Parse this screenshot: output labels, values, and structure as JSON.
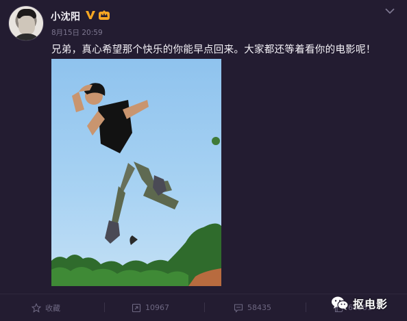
{
  "post": {
    "username": "小沈阳",
    "timestamp": "8月15日 20:59",
    "text": "兄弟，真心希望那个快乐的你能早点回来。大家都还等着看你的电影呢！"
  },
  "actions": {
    "favorite_label": "收藏",
    "repost_count": "10967",
    "comment_count": "58435",
    "like_count": "60551"
  },
  "watermark": {
    "text": "抠电影"
  },
  "icons": {
    "verified": "verified-v-icon",
    "member": "member-crown-icon",
    "more": "chevron-down-icon",
    "favorite": "star-icon",
    "repost": "repost-icon",
    "comment": "comment-icon",
    "like": "thumb-up-icon",
    "watermark_logo": "wechat-icon"
  },
  "colors": {
    "background": "#231c31",
    "verified": "#f5a623",
    "member": "#f5a623",
    "muted_text": "#7d7790"
  }
}
